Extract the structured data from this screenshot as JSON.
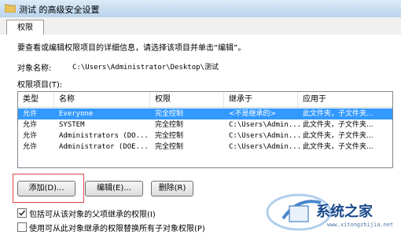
{
  "window": {
    "title": "测试 的高级安全设置"
  },
  "tabs": [
    {
      "label": "权限"
    }
  ],
  "description": "要查看或编辑权限项目的详细信息，请选择该项目并单击“编辑”。",
  "object": {
    "label": "对象名称:",
    "path": "C:\\Users\\Administrator\\Desktop\\测试"
  },
  "entries": {
    "label": "权限项目(T):",
    "columns": [
      "类型",
      "名称",
      "权限",
      "继承于",
      "应用于"
    ],
    "rows": [
      {
        "type": "允许",
        "name": "Everyone",
        "perm": "完全控制",
        "inherited": "<不是继承的>",
        "applies": "此文件夹，子文件夹..."
      },
      {
        "type": "允许",
        "name": "SYSTEM",
        "perm": "完全控制",
        "inherited": "C:\\Users\\Admin...",
        "applies": "此文件夹，子文件夹..."
      },
      {
        "type": "允许",
        "name": "Administrators (DO...",
        "perm": "完全控制",
        "inherited": "C:\\Users\\Admin...",
        "applies": "此文件夹，子文件夹..."
      },
      {
        "type": "允许",
        "name": "Administrator (DOE...",
        "perm": "完全控制",
        "inherited": "C:\\Users\\Admin...",
        "applies": "此文件夹，子文件夹..."
      }
    ]
  },
  "buttons": {
    "add": "添加(D)...",
    "edit": "编辑(E)...",
    "remove": "删除(R)"
  },
  "checkboxes": [
    {
      "label": "包括可从该对象的父项继承的权限(I)",
      "checked": true
    },
    {
      "label": "使用可从此对象继承的权限替换所有子对象权限(P)",
      "checked": false
    }
  ],
  "watermark": {
    "text": "系统之家",
    "url": "www.xitongzhijia.net"
  },
  "colors": {
    "selection": "#3399ff",
    "highlight_box": "#e0474c"
  }
}
